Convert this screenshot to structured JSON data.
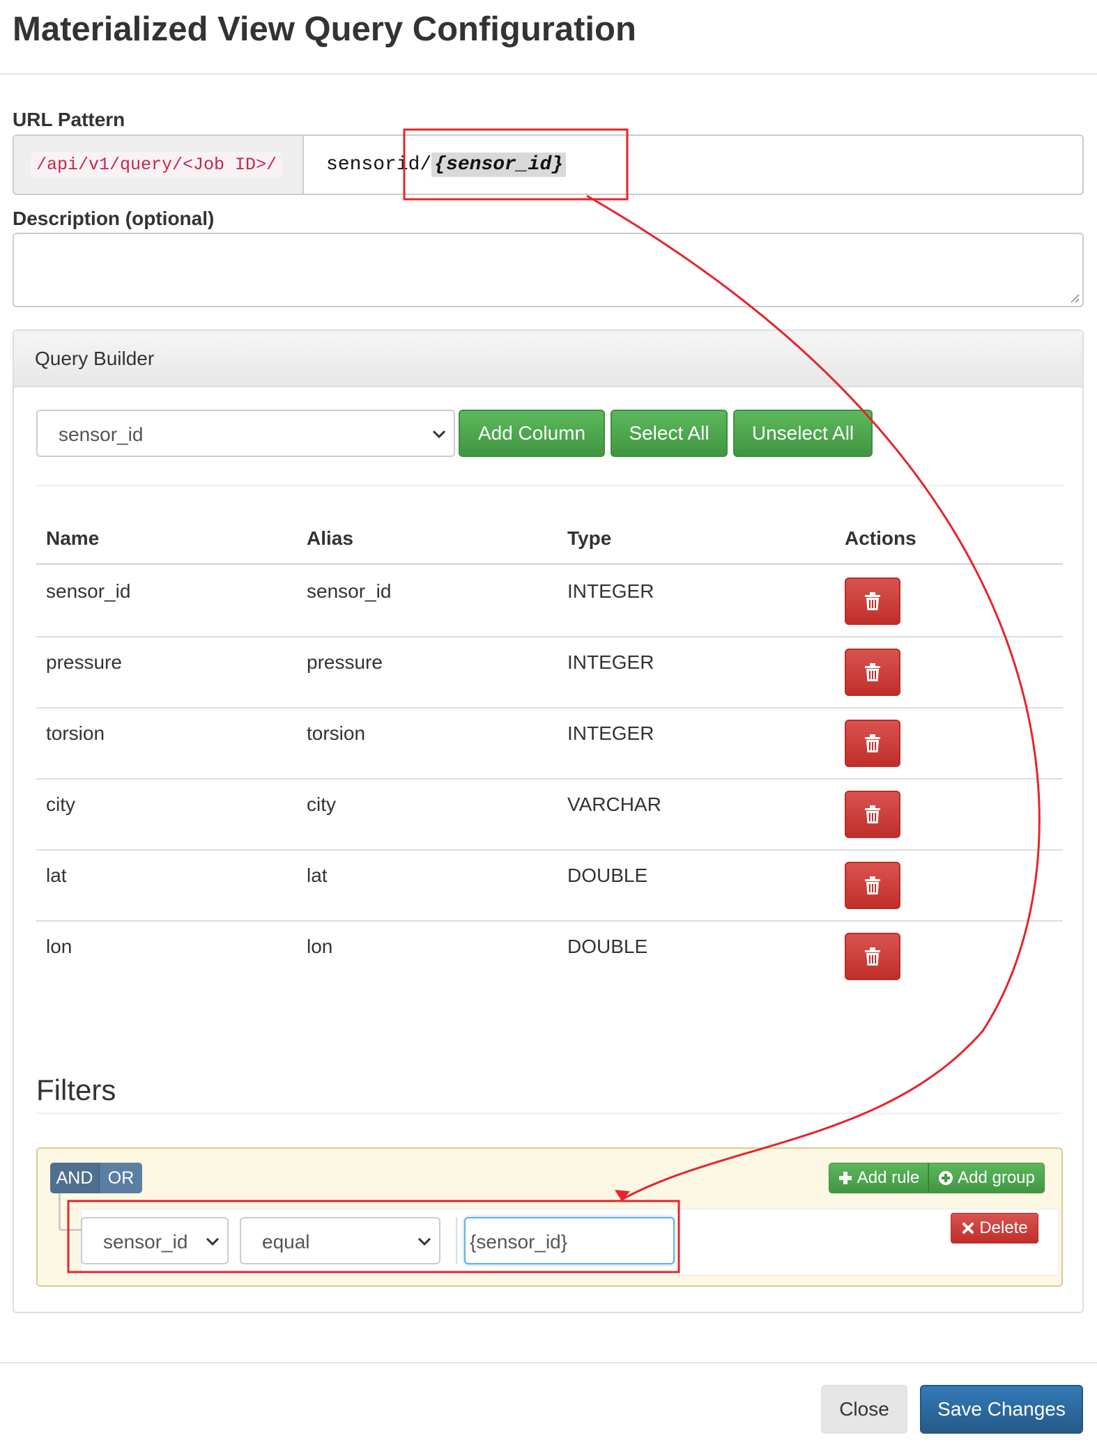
{
  "modal": {
    "title": "Materialized View Query Configuration"
  },
  "url_pattern": {
    "label": "URL Pattern",
    "prefix": "/api/v1/query/<Job ID>/",
    "value_static": "sensorid/",
    "value_variable": "{sensor_id}"
  },
  "description": {
    "label": "Description (optional)",
    "value": ""
  },
  "query_builder": {
    "title": "Query Builder",
    "column_select": "sensor_id",
    "buttons": {
      "add_column": "Add Column",
      "select_all": "Select All",
      "unselect_all": "Unselect All"
    },
    "table": {
      "headers": [
        "Name",
        "Alias",
        "Type",
        "Actions"
      ],
      "rows": [
        {
          "name": "sensor_id",
          "alias": "sensor_id",
          "type": "INTEGER"
        },
        {
          "name": "pressure",
          "alias": "pressure",
          "type": "INTEGER"
        },
        {
          "name": "torsion",
          "alias": "torsion",
          "type": "INTEGER"
        },
        {
          "name": "city",
          "alias": "city",
          "type": "VARCHAR"
        },
        {
          "name": "lat",
          "alias": "lat",
          "type": "DOUBLE"
        },
        {
          "name": "lon",
          "alias": "lon",
          "type": "DOUBLE"
        }
      ],
      "delete_icon": "trash-icon"
    }
  },
  "filters": {
    "title": "Filters",
    "conditions": [
      "AND",
      "OR"
    ],
    "active_condition": "AND",
    "add_rule": "Add rule",
    "add_group": "Add group",
    "rule": {
      "field": "sensor_id",
      "operator": "equal",
      "value": "{sensor_id}",
      "delete": "Delete"
    }
  },
  "footer": {
    "close": "Close",
    "save": "Save Changes"
  },
  "colors": {
    "success": "#449d44",
    "danger": "#d2322d",
    "primary": "#286090",
    "annotation": "#e8232a",
    "filter_group_bg": "#fcf8e3",
    "code_text": "#c7254e"
  }
}
